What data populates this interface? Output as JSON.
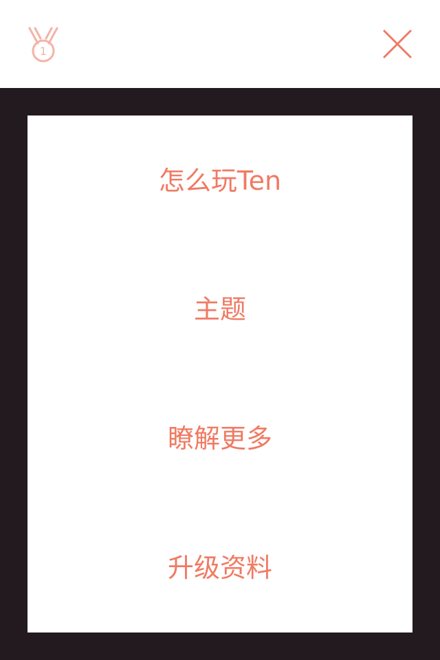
{
  "header": {
    "rank_icon": "medal-icon",
    "rank_number": "1",
    "close_icon": "close-icon"
  },
  "menu": {
    "items": [
      {
        "label": "怎么玩Ten"
      },
      {
        "label": "主题"
      },
      {
        "label": "瞭解更多"
      },
      {
        "label": "升级资料"
      }
    ]
  },
  "colors": {
    "accent": "#f07a63",
    "medal": "#f4b3a7",
    "background": "#231a1f",
    "panel": "#ffffff"
  }
}
